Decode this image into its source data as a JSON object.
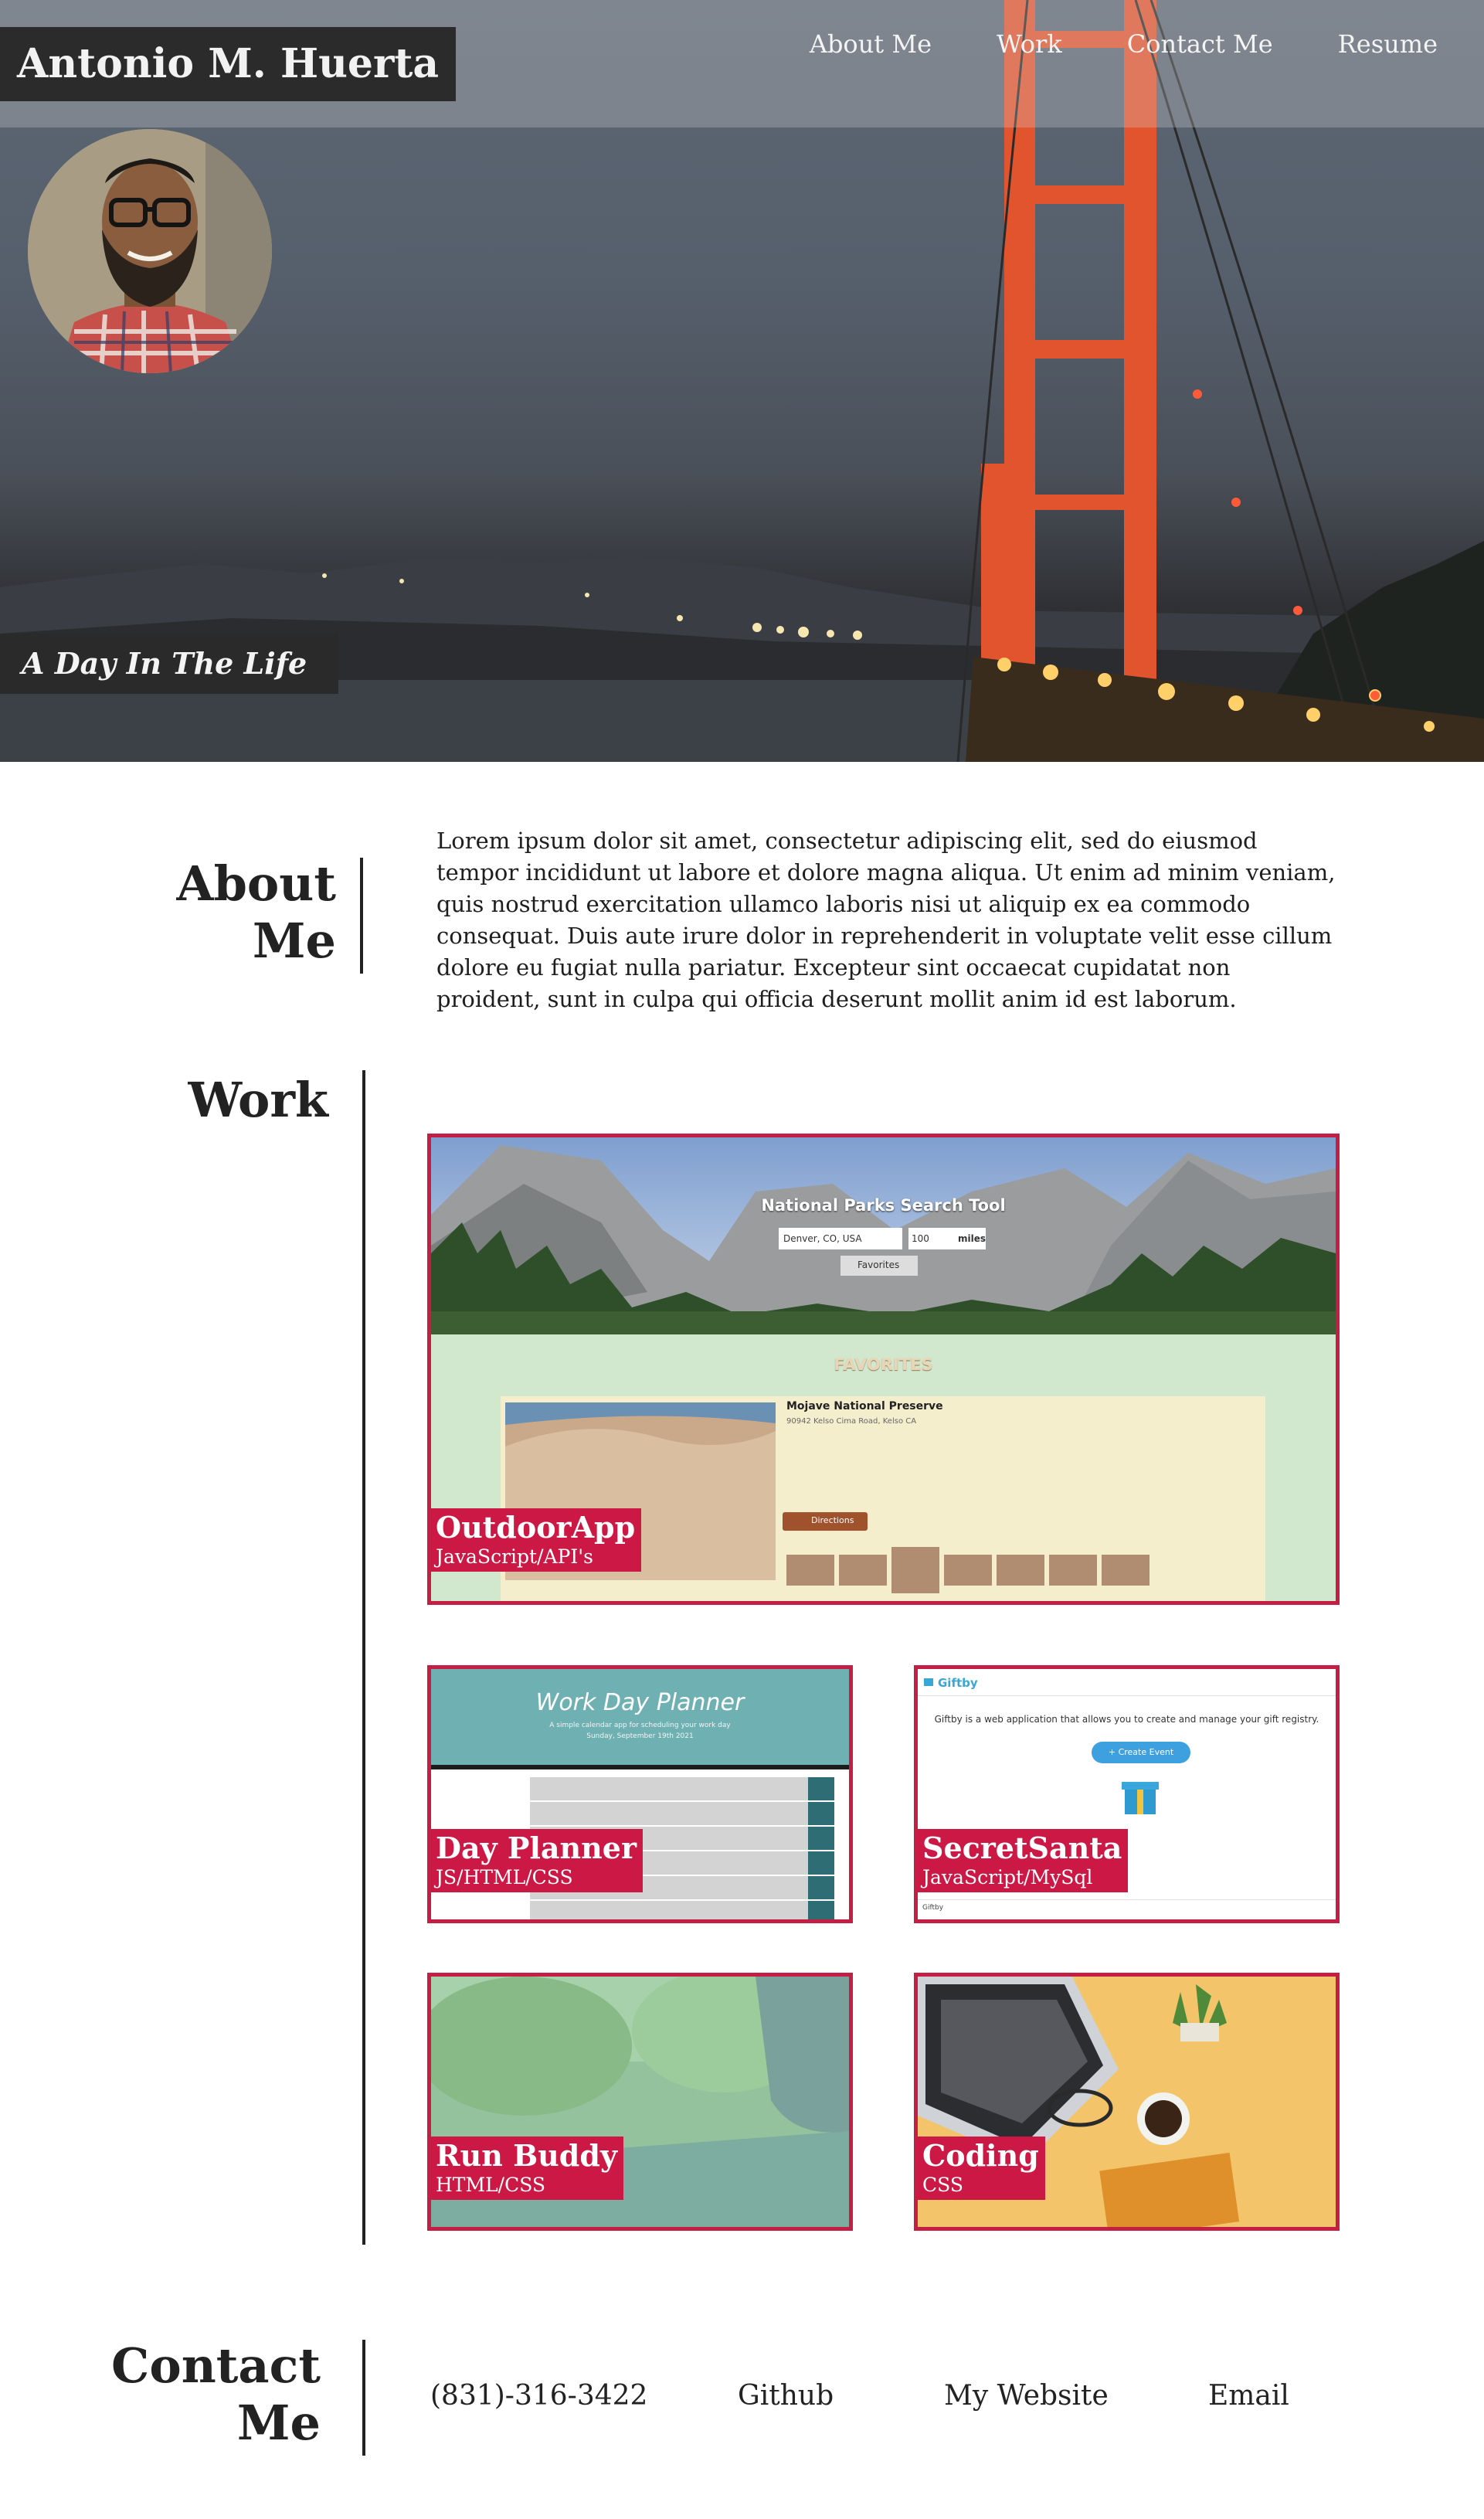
{
  "header": {
    "title": "Antonio M. Huerta",
    "nav": [
      {
        "label": "About Me"
      },
      {
        "label": "Work"
      },
      {
        "label": "Contact Me"
      },
      {
        "label": "Resume"
      }
    ]
  },
  "hero": {
    "caption": "A Day In The Life"
  },
  "about": {
    "heading_line1": "About",
    "heading_line2": "Me",
    "text": "Lorem ipsum dolor sit amet, consectetur adipiscing elit, sed do eiusmod tempor incididunt ut labore et dolore magna aliqua. Ut enim ad minim veniam, quis nostrud exercitation ullamco laboris nisi ut aliquip ex ea commodo consequat. Duis aute irure dolor in reprehenderit in voluptate velit esse cillum dolore eu fugiat nulla pariatur. Excepteur sint occaecat cupidatat non proident, sunt in culpa qui officia deserunt mollit anim id est laborum."
  },
  "work": {
    "heading": "Work",
    "projects": [
      {
        "name": "OutdoorApp",
        "tech": "JavaScript/API's"
      },
      {
        "name": "Day Planner",
        "tech": "JS/HTML/CSS"
      },
      {
        "name": "SecretSanta",
        "tech": "JavaScript/MySql"
      },
      {
        "name": "Run Buddy",
        "tech": "HTML/CSS"
      },
      {
        "name": "Coding",
        "tech": "CSS"
      }
    ],
    "outdoor_preview": {
      "app_title": "National Parks Search Tool",
      "location_value": "Denver, CO, USA",
      "distance_value": "100",
      "distance_unit": "miles",
      "favorites_button": "Favorites",
      "favorites_heading": "FAVORITES",
      "park_name": "Mojave National Preserve",
      "park_address": "90942 Kelso Cima Road, Kelso CA",
      "directions_button": "Directions"
    },
    "planner_preview": {
      "title": "Work Day Planner",
      "subtitle": "A simple calendar app for scheduling your work day",
      "date": "Sunday, September 19th 2021"
    },
    "giftby_preview": {
      "logo": "Giftby",
      "tagline": "Giftby is a web application that allows you to create and manage your gift registry.",
      "create_button": "+ Create Event",
      "footer": "Giftby"
    }
  },
  "contact": {
    "heading_line1": "Contact",
    "heading_line2": "Me",
    "phone": "(831)-316-3422",
    "github": "Github",
    "website": "My Website",
    "email": "Email"
  },
  "colors": {
    "accent": "#cc1845",
    "title_bg": "#2b2b2b",
    "bridge": "#e0502c"
  }
}
